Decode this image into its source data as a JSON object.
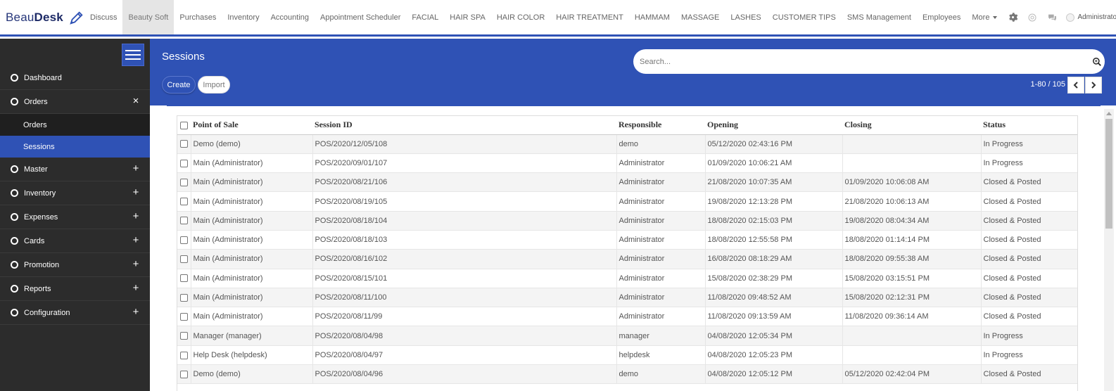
{
  "brand": {
    "logo_part1": "Beau",
    "logo_part2": "Desk",
    "accent_color": "#2f52b5"
  },
  "topnav": {
    "items": [
      "Discuss",
      "Beauty Soft",
      "Purchases",
      "Inventory",
      "Accounting",
      "Appointment Scheduler",
      "FACIAL",
      "HAIR SPA",
      "HAIR COLOR",
      "HAIR TREATMENT",
      "HAMMAM",
      "MASSAGE",
      "LASHES",
      "CUSTOMER TIPS",
      "SMS Management",
      "Employees"
    ],
    "active_item": "Beauty Soft",
    "more_label": "More",
    "user_name": "Administrator",
    "icons": [
      "gear-icon",
      "at-icon",
      "chat-icon"
    ]
  },
  "sidebar": {
    "menu_icon": "hamburger-icon",
    "items": [
      {
        "label": "Dashboard",
        "toggle": ""
      },
      {
        "label": "Orders",
        "toggle": "×"
      },
      {
        "label": "Master",
        "toggle": "+"
      },
      {
        "label": "Inventory",
        "toggle": "+"
      },
      {
        "label": "Expenses",
        "toggle": "+"
      },
      {
        "label": "Cards",
        "toggle": "+"
      },
      {
        "label": "Promotion",
        "toggle": "+"
      },
      {
        "label": "Reports",
        "toggle": "+"
      },
      {
        "label": "Configuration",
        "toggle": "+"
      }
    ],
    "orders_sub": [
      {
        "label": "Orders"
      },
      {
        "label": "Sessions",
        "active": true
      }
    ]
  },
  "header": {
    "title": "Sessions",
    "search_placeholder": "Search...",
    "create_label": "Create",
    "import_label": "Import",
    "pager_text": "1-80 / 105"
  },
  "table": {
    "columns": [
      "Point of Sale",
      "Session ID",
      "Responsible",
      "Opening",
      "Closing",
      "Status"
    ],
    "rows": [
      [
        "Demo (demo)",
        "POS/2020/12/05/108",
        "demo",
        "05/12/2020 02:43:16 PM",
        "",
        "In Progress"
      ],
      [
        "Main (Administrator)",
        "POS/2020/09/01/107",
        "Administrator",
        "01/09/2020 10:06:21 AM",
        "",
        "In Progress"
      ],
      [
        "Main (Administrator)",
        "POS/2020/08/21/106",
        "Administrator",
        "21/08/2020 10:07:35 AM",
        "01/09/2020 10:06:08 AM",
        "Closed & Posted"
      ],
      [
        "Main (Administrator)",
        "POS/2020/08/19/105",
        "Administrator",
        "19/08/2020 12:13:28 PM",
        "21/08/2020 10:06:13 AM",
        "Closed & Posted"
      ],
      [
        "Main (Administrator)",
        "POS/2020/08/18/104",
        "Administrator",
        "18/08/2020 02:15:03 PM",
        "19/08/2020 08:04:34 AM",
        "Closed & Posted"
      ],
      [
        "Main (Administrator)",
        "POS/2020/08/18/103",
        "Administrator",
        "18/08/2020 12:55:58 PM",
        "18/08/2020 01:14:14 PM",
        "Closed & Posted"
      ],
      [
        "Main (Administrator)",
        "POS/2020/08/16/102",
        "Administrator",
        "16/08/2020 08:18:29 AM",
        "18/08/2020 09:55:38 AM",
        "Closed & Posted"
      ],
      [
        "Main (Administrator)",
        "POS/2020/08/15/101",
        "Administrator",
        "15/08/2020 02:38:29 PM",
        "15/08/2020 03:15:51 PM",
        "Closed & Posted"
      ],
      [
        "Main (Administrator)",
        "POS/2020/08/11/100",
        "Administrator",
        "11/08/2020 09:48:52 AM",
        "15/08/2020 02:12:31 PM",
        "Closed & Posted"
      ],
      [
        "Main (Administrator)",
        "POS/2020/08/11/99",
        "Administrator",
        "11/08/2020 09:13:59 AM",
        "11/08/2020 09:36:14 AM",
        "Closed & Posted"
      ],
      [
        "Manager (manager)",
        "POS/2020/08/04/98",
        "manager",
        "04/08/2020 12:05:34 PM",
        "",
        "In Progress"
      ],
      [
        "Help Desk (helpdesk)",
        "POS/2020/08/04/97",
        "helpdesk",
        "04/08/2020 12:05:23 PM",
        "",
        "In Progress"
      ],
      [
        "Demo (demo)",
        "POS/2020/08/04/96",
        "demo",
        "04/08/2020 12:05:12 PM",
        "05/12/2020 02:42:04 PM",
        "Closed & Posted"
      ]
    ]
  }
}
